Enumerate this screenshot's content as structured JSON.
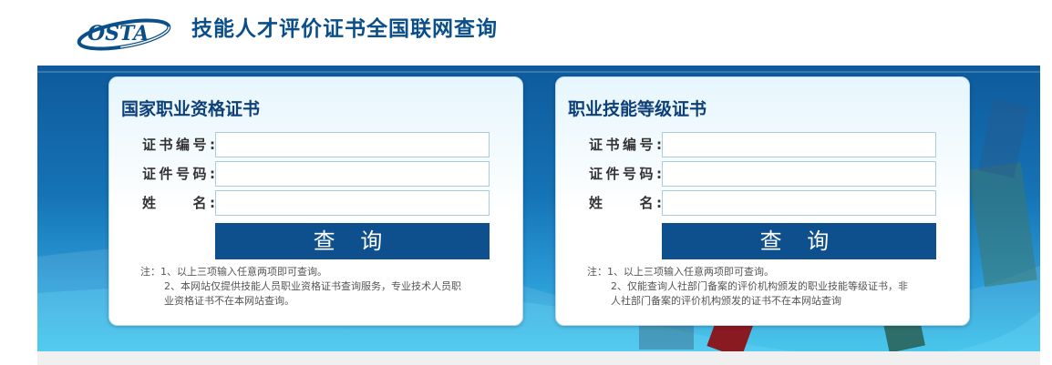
{
  "header": {
    "logo_text": "OSTA",
    "title": "技能人才评价证书全国联网查询"
  },
  "cards": [
    {
      "title": "国家职业资格证书",
      "fields": [
        {
          "label": "证书编号:",
          "value": "",
          "placeholder": ""
        },
        {
          "label": "证件号码:",
          "value": "",
          "placeholder": ""
        },
        {
          "label": "姓　　名:",
          "value": "",
          "placeholder": ""
        }
      ],
      "button": "查 询",
      "notes": [
        "注：1、以上三项输入任意两项即可查询。",
        "2、本网站仅提供技能人员职业资格证书查询服务，专业技术人员职",
        "业资格证书不在本网站查询。"
      ]
    },
    {
      "title": "职业技能等级证书",
      "fields": [
        {
          "label": "证书编号:",
          "value": "",
          "placeholder": ""
        },
        {
          "label": "证件号码:",
          "value": "",
          "placeholder": ""
        },
        {
          "label": "姓　　名:",
          "value": "",
          "placeholder": ""
        }
      ],
      "button": "查 询",
      "notes": [
        "注：1、以上三项输入任意两项即可查询。",
        "2、仅能查询人社部门备案的评价机构颁发的职业技能等级证书，非",
        "人社部门备案的评价机构颁发的证书不在本网站查询"
      ]
    }
  ],
  "colors": {
    "brand": "#0b4f8a",
    "button": "#0e4f8d",
    "banner_top": "#0e5a9c",
    "banner_bottom": "#34c0ea"
  }
}
